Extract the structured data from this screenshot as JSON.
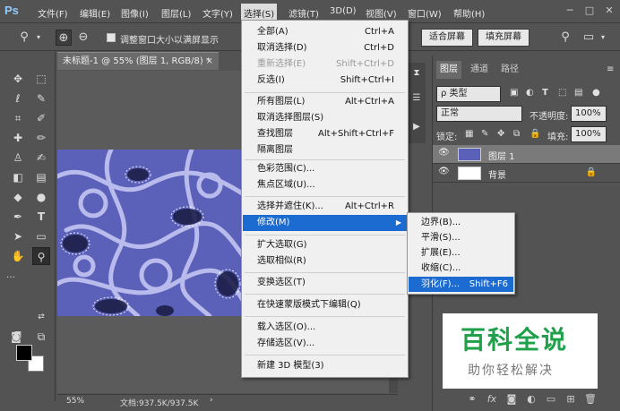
{
  "app": {
    "logo": "Ps"
  },
  "menubar": {
    "items": [
      "文件(F)",
      "编辑(E)",
      "图像(I)",
      "图层(L)",
      "文字(Y)",
      "选择(S)",
      "滤镜(T)",
      "3D(D)",
      "视图(V)",
      "窗口(W)",
      "帮助(H)"
    ],
    "active": "选择(S)"
  },
  "options": {
    "resize_window_label": "调整窗口大小以满屏显示",
    "fit_screen_label": "适合屏幕",
    "fill_screen_label": "填充屏幕"
  },
  "document": {
    "tab_title": "未标题-1 @ 55% (图层 1, RGB/8) *",
    "close": "×",
    "zoom": "55%",
    "doc_info": "文档:937.5K/937.5K"
  },
  "select_menu": {
    "items": [
      {
        "label": "全部(A)",
        "shortcut": "Ctrl+A",
        "disabled": false
      },
      {
        "label": "取消选择(D)",
        "shortcut": "Ctrl+D",
        "disabled": false
      },
      {
        "label": "重新选择(E)",
        "shortcut": "Shift+Ctrl+D",
        "disabled": true
      },
      {
        "label": "反选(I)",
        "shortcut": "Shift+Ctrl+I",
        "disabled": false
      },
      {
        "label": "所有图层(L)",
        "shortcut": "Alt+Ctrl+A",
        "disabled": false
      },
      {
        "label": "取消选择图层(S)",
        "shortcut": "",
        "disabled": false
      },
      {
        "label": "查找图层",
        "shortcut": "Alt+Shift+Ctrl+F",
        "disabled": false
      },
      {
        "label": "隔离图层",
        "shortcut": "",
        "disabled": false
      },
      {
        "label": "色彩范围(C)...",
        "shortcut": "",
        "disabled": false
      },
      {
        "label": "焦点区域(U)...",
        "shortcut": "",
        "disabled": false
      },
      {
        "label": "选择并遮住(K)...",
        "shortcut": "Alt+Ctrl+R",
        "disabled": false
      },
      {
        "label": "修改(M)",
        "shortcut": "",
        "disabled": false,
        "submenu": true,
        "hover": true
      },
      {
        "label": "扩大选取(G)",
        "shortcut": "",
        "disabled": false
      },
      {
        "label": "选取相似(R)",
        "shortcut": "",
        "disabled": false
      },
      {
        "label": "变换选区(T)",
        "shortcut": "",
        "disabled": false
      },
      {
        "label": "在快速蒙版模式下编辑(Q)",
        "shortcut": "",
        "disabled": false
      },
      {
        "label": "载入选区(O)...",
        "shortcut": "",
        "disabled": false
      },
      {
        "label": "存储选区(V)...",
        "shortcut": "",
        "disabled": false
      },
      {
        "label": "新建 3D 模型(3)",
        "shortcut": "",
        "disabled": false
      }
    ]
  },
  "modify_submenu": {
    "items": [
      {
        "label": "边界(B)...",
        "shortcut": ""
      },
      {
        "label": "平滑(S)...",
        "shortcut": ""
      },
      {
        "label": "扩展(E)...",
        "shortcut": ""
      },
      {
        "label": "收缩(C)...",
        "shortcut": ""
      },
      {
        "label": "羽化(F)...",
        "shortcut": "Shift+F6",
        "hover": true
      }
    ]
  },
  "layers_panel": {
    "tabs": [
      "图层",
      "通道",
      "路径"
    ],
    "active_tab": "图层",
    "filter_label": "ρ 类型",
    "blend_mode": "正常",
    "opacity_label": "不透明度:",
    "opacity_value": "100%",
    "lock_label": "锁定:",
    "fill_label": "填充:",
    "fill_value": "100%",
    "layers": [
      {
        "name": "图层 1",
        "active": true
      },
      {
        "name": "背景",
        "locked": true
      }
    ]
  },
  "watermark": {
    "title": "百科全说",
    "subtitle": "助你轻松解决"
  }
}
